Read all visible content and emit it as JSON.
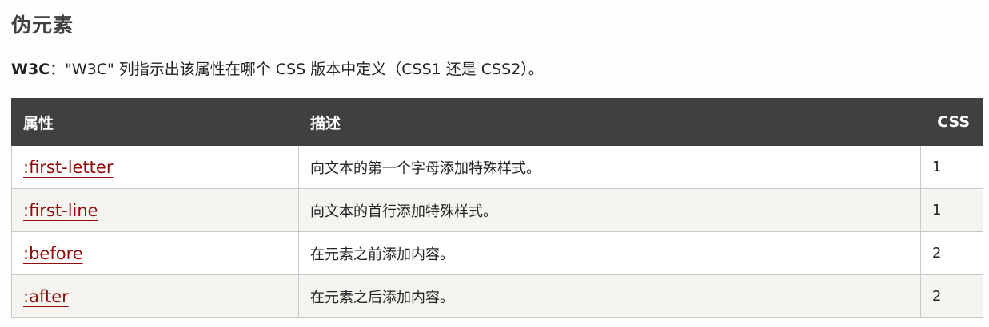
{
  "section": {
    "title": "伪元素"
  },
  "note": {
    "label": "W3C",
    "text": "：\"W3C\" 列指示出该属性在哪个 CSS 版本中定义（CSS1 还是 CSS2）。"
  },
  "table": {
    "headers": {
      "property": "属性",
      "description": "描述",
      "css": "CSS"
    },
    "rows": [
      {
        "selector": ":first-letter",
        "description": "向文本的第一个字母添加特殊样式。",
        "css": "1"
      },
      {
        "selector": ":first-line",
        "description": "向文本的首行添加特殊样式。",
        "css": "1"
      },
      {
        "selector": ":before",
        "description": "在元素之前添加内容。",
        "css": "2"
      },
      {
        "selector": ":after",
        "description": "在元素之后添加内容。",
        "css": "2"
      }
    ]
  },
  "colors": {
    "header_bg": "#404040",
    "link": "#900b09",
    "row_alt": "#f6f4f0"
  }
}
